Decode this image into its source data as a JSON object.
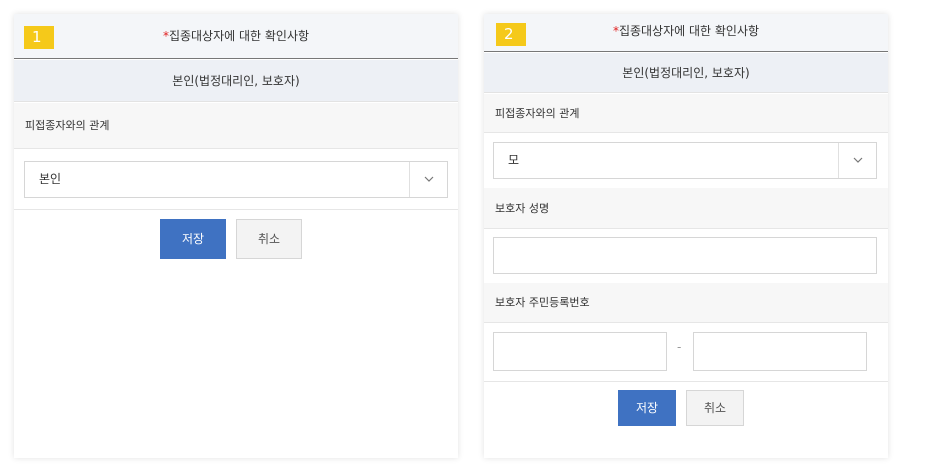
{
  "panel1": {
    "number": "1",
    "header": {
      "star": "*",
      "title": "집종대상자에 대한 확인사항"
    },
    "subheader": "본인(법정대리인, 보호자)",
    "relation_label": "피접종자와의 관계",
    "relation_select": {
      "value": "본인",
      "icon": "chevron-down-icon"
    },
    "save_label": "저장",
    "cancel_label": "취소"
  },
  "panel2": {
    "number": "2",
    "header": {
      "star": "*",
      "title": "집종대상자에 대한 확인사항"
    },
    "subheader": "본인(법정대리인, 보호자)",
    "relation_label": "피접종자와의 관계",
    "relation_select": {
      "value": "모",
      "icon": "chevron-down-icon"
    },
    "guardian_name_label": "보호자 성명",
    "guardian_name_value": "",
    "guardian_rrn_label": "보호자 주민등록번호",
    "rrn_separator": "-",
    "save_label": "저장",
    "cancel_label": "취소"
  },
  "colors": {
    "badge": "#f5c91a",
    "star": "#e02020",
    "save_button": "#3f72c2",
    "header_bg": "#f4f6f9"
  }
}
